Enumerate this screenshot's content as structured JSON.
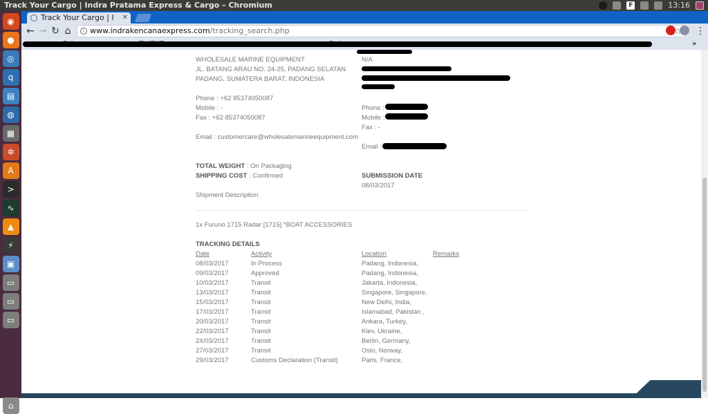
{
  "window": {
    "title": "Track Your Cargo | Indra Pratama Express & Cargo – Chromium",
    "clock": "13:16"
  },
  "browser": {
    "tab_title": "Track Your Cargo | I",
    "url_domain": "www.indrakencanaexpress.com",
    "url_path": "/tracking_search.php"
  },
  "bookmarks": [
    "Drivers",
    "TV/TNT",
    "Dates"
  ],
  "shipper": {
    "company": "WHOLESALE MARINE EQUIPMENT",
    "address1": "JL. BATANG ARAU NO. 24-25, PADANG SELATAN",
    "address2": "PADANG, SUMATERA BARAT, INDONESIA",
    "phone": "Phone : +62 85374050087",
    "mobile": "Mobile : -",
    "fax": "Fax : +62 85374050087",
    "email": "Email : customercare@wholesalemarineequipment.com"
  },
  "receiver": {
    "company": "N/A",
    "phone": "Phone :",
    "mobile": "Mobile :",
    "fax": "Fax : -",
    "email": "Email :"
  },
  "summary": {
    "weight_label": "TOTAL WEIGHT",
    "weight_value": " : On Packaging",
    "cost_label": "SHIPPING COST",
    "cost_value": " : Confirmed",
    "submission_label": "SUBMISSION DATE",
    "submission_value": "08/03/2017",
    "shipment_desc_label": "Shipment Description"
  },
  "item": "1x Furuno 1715 Radar [1715] *BOAT ACCESSORIES",
  "tracking": {
    "heading": "TRACKING DETAILS",
    "columns": [
      "Date",
      "Activity",
      "Location",
      "Remarks"
    ],
    "rows": [
      {
        "date": "08/03/2017",
        "activity": "In Process",
        "location": "Padang, Indonesia,"
      },
      {
        "date": "09/03/2017",
        "activity": "Approved",
        "location": "Padang, Indonesia,"
      },
      {
        "date": "10/03/2017",
        "activity": "Transit",
        "location": "Jakarta, Indonesia,"
      },
      {
        "date": "13/03/2017",
        "activity": "Transit",
        "location": "Singapore, Singapore,"
      },
      {
        "date": "15/03/2017",
        "activity": "Transit",
        "location": "New Delhi, India,"
      },
      {
        "date": "17/03/2017",
        "activity": "Transit",
        "location": "Islamabad, Pakistan ,"
      },
      {
        "date": "20/03/2017",
        "activity": "Transit",
        "location": "Ankara, Turkey,"
      },
      {
        "date": "22/03/2017",
        "activity": "Transit",
        "location": "Kiev, Ukraine,"
      },
      {
        "date": "24/03/2017",
        "activity": "Transit",
        "location": "Berlin, Germany,"
      },
      {
        "date": "27/03/2017",
        "activity": "Transit",
        "location": "Oslo, Norway,"
      },
      {
        "date": "29/03/2017",
        "activity": "Customs Declaration (Transit)",
        "location": "Paris, France,"
      }
    ]
  }
}
